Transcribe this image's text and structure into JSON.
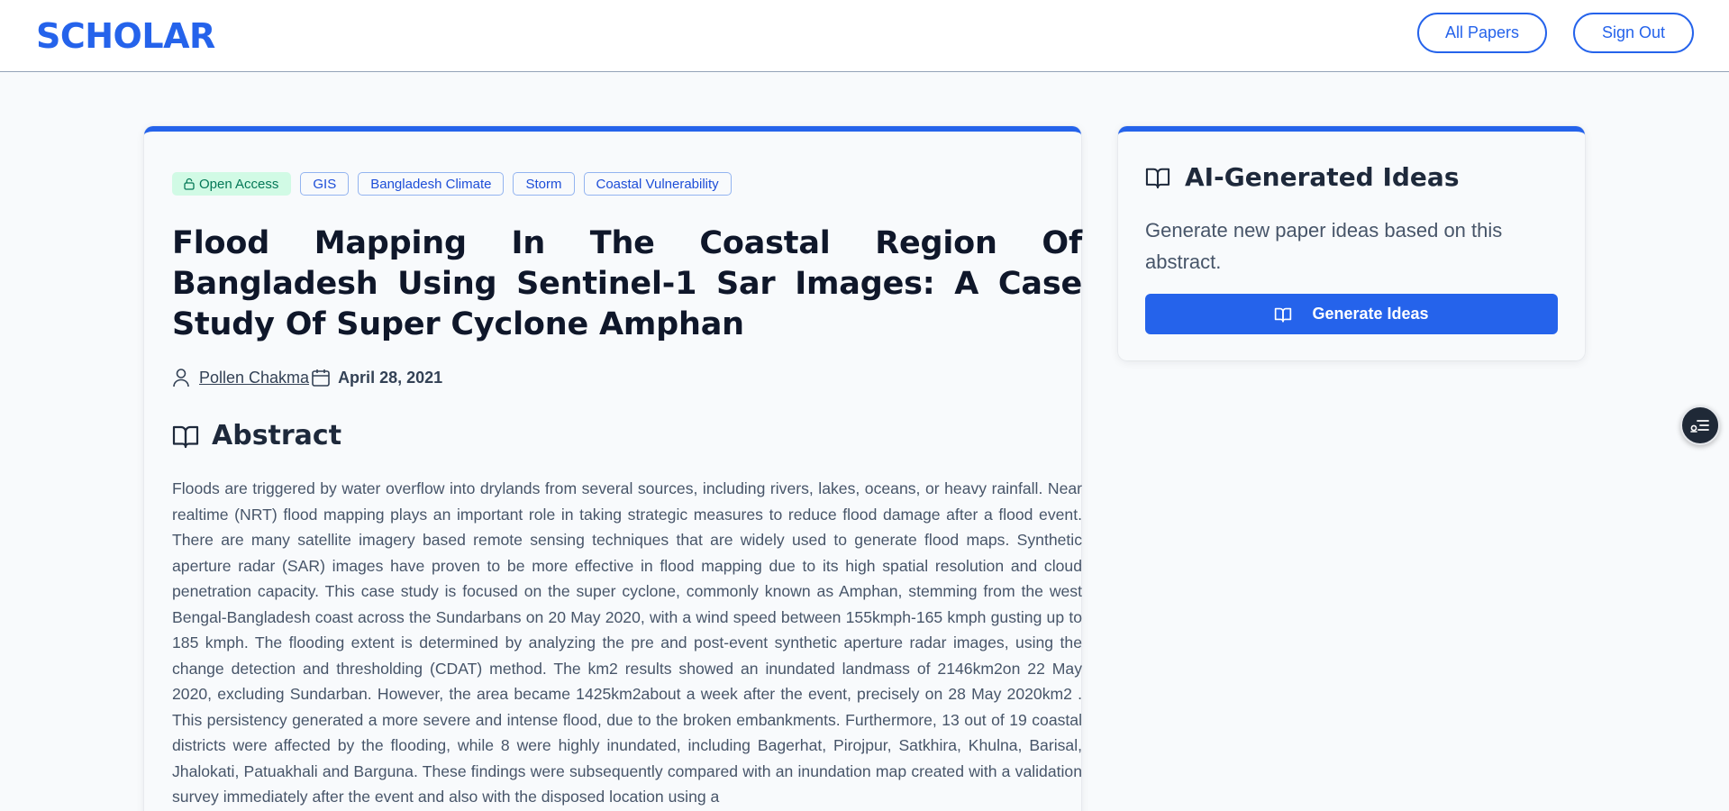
{
  "header": {
    "brand": "SCHOLAR",
    "all_papers_label": "All Papers",
    "sign_out_label": "Sign Out"
  },
  "paper": {
    "tags": [
      {
        "label": "Open Access",
        "type": "access",
        "icon": "lock-icon"
      },
      {
        "label": "GIS",
        "type": "topic"
      },
      {
        "label": "Bangladesh Climate",
        "type": "topic"
      },
      {
        "label": "Storm",
        "type": "topic"
      },
      {
        "label": "Coastal Vulnerability",
        "type": "topic"
      }
    ],
    "title": "Flood Mapping In The Coastal Region Of Bangladesh Using Sentinel-1 Sar Images: A Case Study Of Super Cyclone Amphan",
    "author": "Pollen Chakma",
    "date": "April 28, 2021",
    "abstract_heading": "Abstract",
    "abstract": "Floods are triggered by water overflow into drylands from several sources, including rivers, lakes, oceans, or heavy rainfall. Near realtime (NRT) flood mapping plays an important role in taking strategic measures to reduce flood damage after a flood event. There are many satellite imagery based remote sensing techniques that are widely used to generate flood maps. Synthetic aperture radar (SAR) images have proven to be more effective in flood mapping due to its high spatial resolution and cloud penetration capacity. This case study is focused on the super cyclone, commonly known as Amphan, stemming from the west Bengal-Bangladesh coast across the Sundarbans on 20 May 2020, with a wind speed between 155kmph-165 kmph gusting up to 185 kmph. The flooding extent is determined by analyzing the pre and post-event synthetic aperture radar images, using the change detection and thresholding (CDAT) method. The km2 results showed an inundated landmass of 2146km2on 22 May 2020, excluding Sundarban. However, the area became 1425km2about a week after the event, precisely on 28 May 2020km2 . This persistency generated a more severe and intense flood, due to the broken embankments. Furthermore, 13 out of 19 coastal districts were affected by the flooding, while 8 were highly inundated, including Bagerhat, Pirojpur, Satkhira, Khulna, Barisal, Jhalokati, Patuakhali and Barguna. These findings were subsequently compared with an inundation map created with a validation survey immediately after the event and also with the disposed location using a"
  },
  "sidebar": {
    "title": "AI-Generated Ideas",
    "description": "Generate new paper ideas based on this abstract.",
    "button_label": "Generate Ideas"
  },
  "colors": {
    "accent": "#2563eb",
    "open_access_bg": "#d1fae5",
    "open_access_text": "#047857"
  }
}
